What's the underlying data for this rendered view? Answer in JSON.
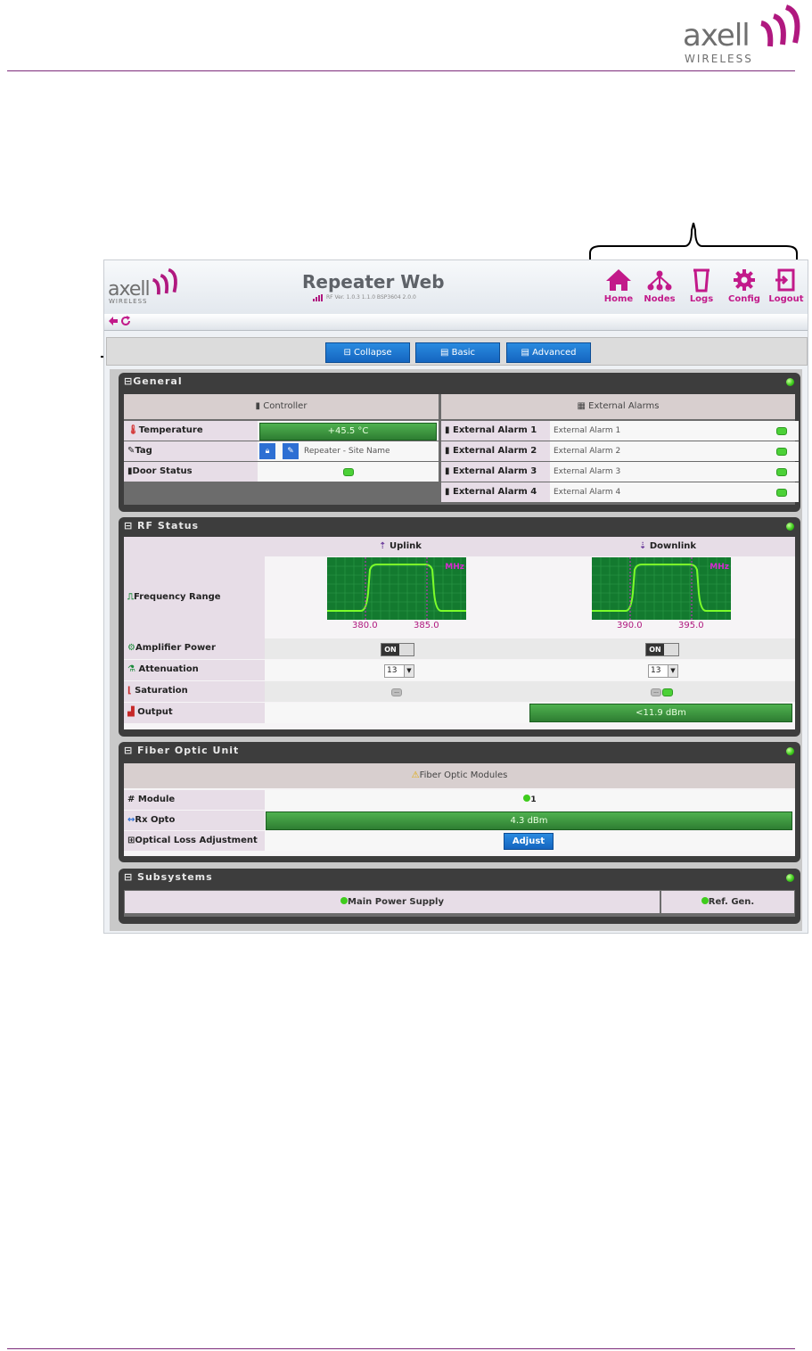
{
  "doc": {
    "logo_text": "axell",
    "logo_sub": "WIRELESS"
  },
  "app": {
    "logo_text": "axell",
    "logo_sub": "WIRELESS",
    "title": "Repeater Web",
    "version": "RF Ver. 1.0.3 1.1.0 BSP3604 2.0.0",
    "nav": [
      {
        "label": "Home",
        "icon": "home-icon"
      },
      {
        "label": "Nodes",
        "icon": "nodes-icon"
      },
      {
        "label": "Logs",
        "icon": "logs-icon"
      },
      {
        "label": "Config",
        "icon": "gear-icon"
      },
      {
        "label": "Logout",
        "icon": "logout-icon"
      }
    ],
    "buttons": {
      "collapse": "Collapse",
      "basic": "Basic",
      "advanced": "Advanced"
    }
  },
  "general": {
    "title": "General",
    "controller_header": "Controller",
    "alarms_header": "External Alarms",
    "temperature_label": "Temperature",
    "temperature_value": "+45.5 °C",
    "tag_label": "Tag",
    "tag_value": "Repeater - Site Name",
    "door_label": "Door Status",
    "alarms": [
      {
        "label": "External Alarm 1",
        "value": "External Alarm 1"
      },
      {
        "label": "External Alarm 2",
        "value": "External Alarm 2"
      },
      {
        "label": "External Alarm 3",
        "value": "External Alarm 3"
      },
      {
        "label": "External Alarm 4",
        "value": "External Alarm 4"
      }
    ]
  },
  "rf": {
    "title": "RF Status",
    "uplink": "Uplink",
    "downlink": "Downlink",
    "freq_label": "Frequency Range",
    "graph_unit": "MHz",
    "uplink_low": "380.0",
    "uplink_high": "385.0",
    "downlink_low": "390.0",
    "downlink_high": "395.0",
    "amp_label": "Amplifier Power",
    "amp_uplink": "ON",
    "amp_downlink": "ON",
    "att_label": "Attenuation",
    "att_uplink": "13",
    "att_downlink": "13",
    "sat_label": "Saturation",
    "sat_uplink": "...",
    "sat_downlink": "...",
    "output_label": "Output",
    "output_value": "<11.9 dBm"
  },
  "fiber": {
    "title": "Fiber Optic Unit",
    "modules_header": "Fiber Optic Modules",
    "module_label": "Module",
    "module_value": "1",
    "rx_label": "Rx Opto",
    "rx_value": "4.3 dBm",
    "loss_label": "Optical Loss Adjustment",
    "adjust_button": "Adjust"
  },
  "subsystems": {
    "title": "Subsystems",
    "items": [
      "Main Power Supply",
      "Ref. Gen."
    ]
  }
}
